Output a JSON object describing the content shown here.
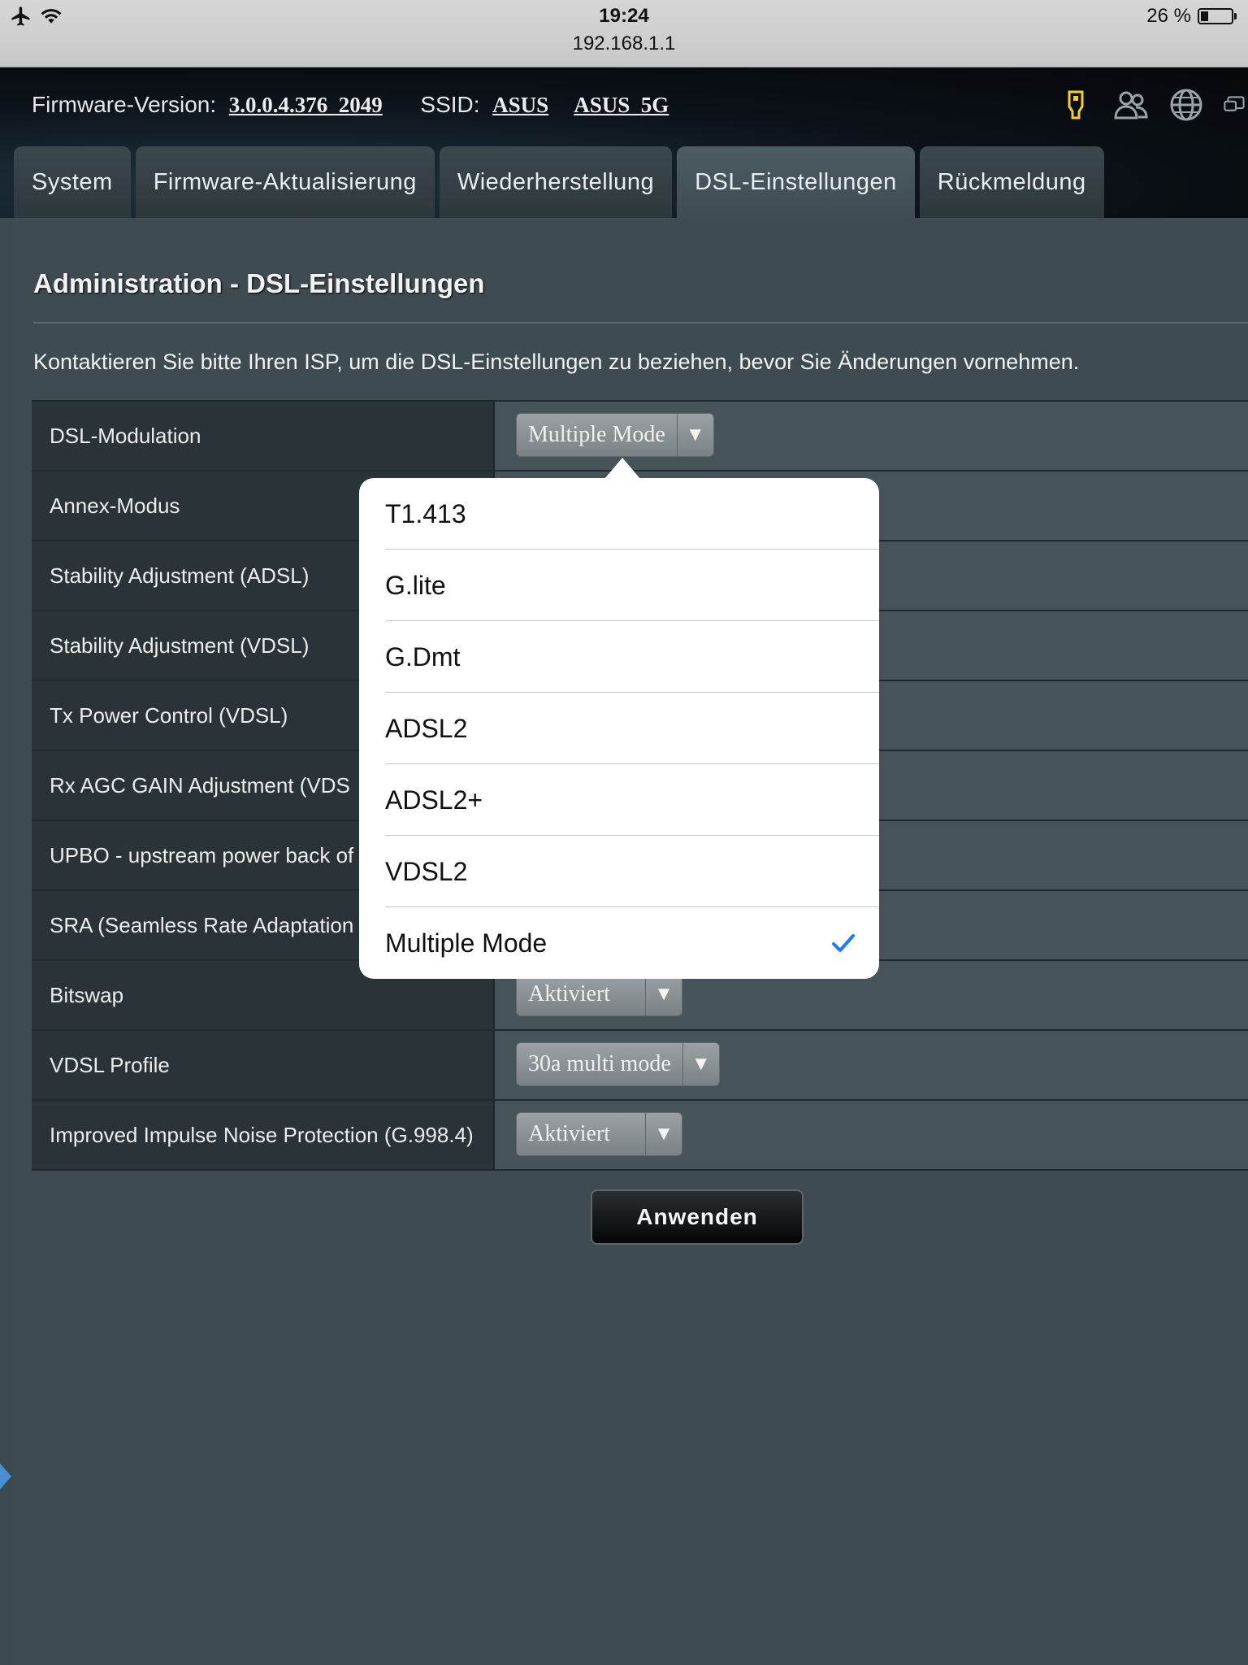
{
  "status_bar": {
    "time": "19:24",
    "url": "192.168.1.1",
    "battery_text": "26 %",
    "battery_level": 0.26,
    "icons": [
      "airplane-icon",
      "wifi-icon"
    ]
  },
  "header": {
    "firmware_label": "Firmware-Version:",
    "firmware_version": "3.0.0.4.376_2049",
    "ssid_label": "SSID:",
    "ssid_1": "ASUS",
    "ssid_2": "ASUS_5G",
    "icons": [
      "usb-icon",
      "clients-icon",
      "globe-icon",
      "network-icon"
    ],
    "usb_icon_color": "#f2d21b"
  },
  "tabs": [
    {
      "label": "System",
      "active": false
    },
    {
      "label": "Firmware-Aktualisierung",
      "active": false
    },
    {
      "label": "Wiederherstellung",
      "active": false
    },
    {
      "label": "DSL-Einstellungen",
      "active": true
    },
    {
      "label": "Rückmeldung",
      "active": false
    }
  ],
  "main": {
    "title": "Administration - DSL-Einstellungen",
    "description": "Kontaktieren Sie bitte Ihren ISP, um die DSL-Einstellungen zu beziehen, bevor Sie Änderungen vornehmen.",
    "rows": [
      {
        "label": "DSL-Modulation",
        "value": "Multiple Mode"
      },
      {
        "label": "Annex-Modus",
        "value": ""
      },
      {
        "label": "Stability Adjustment (ADSL)",
        "value": ""
      },
      {
        "label": "Stability Adjustment (VDSL)",
        "value": ""
      },
      {
        "label": "Tx Power Control (VDSL)",
        "value": ""
      },
      {
        "label": "Rx AGC GAIN Adjustment (VDS",
        "value": ""
      },
      {
        "label": "UPBO - upstream power back of",
        "value": ""
      },
      {
        "label": "SRA (Seamless Rate Adaptation",
        "value": ""
      },
      {
        "label": "Bitswap",
        "value": "Aktiviert"
      },
      {
        "label": "VDSL Profile",
        "value": "30a multi mode"
      },
      {
        "label": "Improved Impulse Noise Protection (G.998.4)",
        "value": "Aktiviert"
      }
    ],
    "apply_label": "Anwenden"
  },
  "popover": {
    "options": [
      "T1.413",
      "G.lite",
      "G.Dmt",
      "ADSL2",
      "ADSL2+",
      "VDSL2",
      "Multiple Mode"
    ],
    "selected": "Multiple Mode",
    "check_color": "#1a7cf5"
  }
}
